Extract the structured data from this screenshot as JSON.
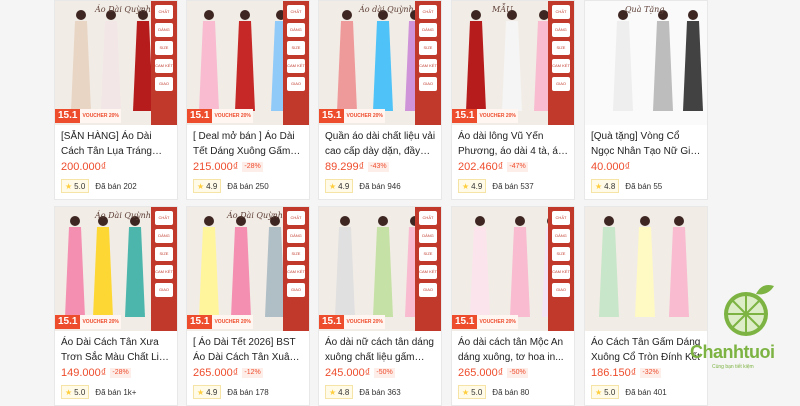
{
  "products": [
    {
      "title": "[SẴN HÀNG] Áo Dài Cách Tân Lụa Tráng Gương, Á...",
      "price": "200.000₫",
      "discount": "",
      "rating": "5.0",
      "sold": "Đã bán 202",
      "thumb_text": "Áo Dài Quỳnh Anh",
      "date_badge": "15.1",
      "voucher": "VOUCHER 20%"
    },
    {
      "title": "[ Deal mở bán ] Áo Dài Tết Dáng Xuông Gấm Thọ R...",
      "price": "215.000₫",
      "discount": "-28%",
      "rating": "4.9",
      "sold": "Đã bán 250",
      "thumb_text": "",
      "date_badge": "15.1",
      "voucher": "VOUCHER 20%"
    },
    {
      "title": "Quần áo dài chất liệu vải cao cấp dày dặn, đầy đủ...",
      "price": "89.299₫",
      "discount": "-43%",
      "rating": "4.9",
      "sold": "Đã bán 946",
      "thumb_text": "Áo dài Quỳnh Anh",
      "date_badge": "15.1",
      "voucher": "VOUCHER 20%"
    },
    {
      "title": "Áo dài lông Vũ Yến Phương, áo dài 4 tà, áo ...",
      "price": "202.460₫",
      "discount": "-47%",
      "rating": "4.9",
      "sold": "Đã bán 537",
      "thumb_text": "MẪU",
      "date_badge": "15.1",
      "voucher": "VOUCHER 20%"
    },
    {
      "title": "[Quà tặng] Vòng Cổ Ngọc Nhân Tạo Nữ Giá Tốt Ph...",
      "price": "40.000₫",
      "discount": "",
      "rating": "4.8",
      "sold": "Đã bán 55",
      "thumb_text": "Quà Tặng",
      "date_badge": "",
      "voucher": ""
    },
    {
      "title": "Áo Dài Cách Tân Xưa Trơn Sắc Màu Chất Liệu Lụa T...",
      "price": "149.000₫",
      "discount": "-28%",
      "rating": "5.0",
      "sold": "Đã bán 1k+",
      "thumb_text": "Áo Dài Quỳnh Anh",
      "date_badge": "15.1",
      "voucher": "VOUCHER 20%"
    },
    {
      "title": "[ Áo Dài Tết 2026] BST Áo Dài Cách Tân Xuân Thì,...",
      "price": "265.000₫",
      "discount": "-12%",
      "rating": "4.9",
      "sold": "Đã bán 178",
      "thumb_text": "Áo Dài Quỳnh Anh",
      "date_badge": "15.1",
      "voucher": "VOUCHER 20%"
    },
    {
      "title": "Áo dài nữ cách tân dáng xuông chất liệu gấm Liễu...",
      "price": "245.000₫",
      "discount": "-50%",
      "rating": "4.8",
      "sold": "Đã bán 363",
      "thumb_text": "",
      "date_badge": "15.1",
      "voucher": "VOUCHER 20%"
    },
    {
      "title": "Áo dài cách tân Mộc An dáng xuông, tơ hoa in...",
      "price": "265.000₫",
      "discount": "-50%",
      "rating": "5.0",
      "sold": "Đã bán 80",
      "thumb_text": "",
      "date_badge": "15.1",
      "voucher": "VOUCHER 20%"
    },
    {
      "title": "Áo Cách Tân Gấm Dáng Xuông Cổ Tròn Đính Kết",
      "price": "186.150₫",
      "discount": "-32%",
      "rating": "5.0",
      "sold": "Đã bán 401",
      "thumb_text": "",
      "date_badge": "",
      "voucher": ""
    }
  ],
  "thumb_colors": [
    [
      "#e8d5c4",
      "#f3e6e6",
      "#b71c1c"
    ],
    [
      "#f8bbd0",
      "#c62828",
      "#90caf9"
    ],
    [
      "#ef9a9a",
      "#4fc3f7",
      "#ce93d8"
    ],
    [
      "#b71c1c",
      "#f5f5f5",
      "#f8bbd0"
    ],
    [
      "#eeeeee",
      "#bdbdbd",
      "#424242"
    ],
    [
      "#f48fb1",
      "#fdd835",
      "#4db6ac"
    ],
    [
      "#fff59d",
      "#f48fb1",
      "#b0bec5"
    ],
    [
      "#e0e0e0",
      "#c5e1a5",
      "#f8bbd0"
    ],
    [
      "#fce4ec",
      "#f8bbd0",
      "#f3e5f5"
    ],
    [
      "#c8e6c9",
      "#fff9c4",
      "#f8bbd0"
    ]
  ],
  "side_strip_items": [
    "CHẤT LIỆU",
    "DÁNG",
    "SIZE",
    "CAM KẾT",
    "GIAO"
  ],
  "watermark": {
    "brand": "Chanhtuoi",
    "tagline": "Cùng bạn tiết kiệm"
  },
  "colors": {
    "accent": "#ee4d2d",
    "brand_green": "#7cb342",
    "star": "#ffce3d"
  }
}
